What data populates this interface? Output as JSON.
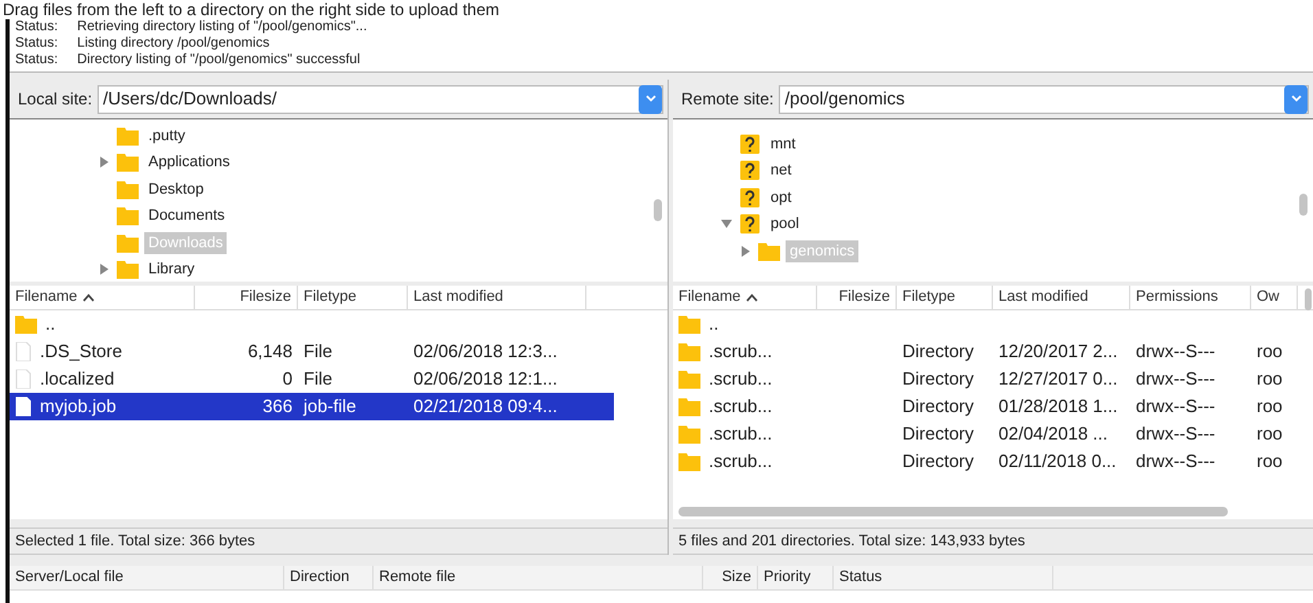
{
  "caption": "Drag files from the left to a directory on the right side to upload them",
  "log": [
    {
      "label": "Status:",
      "message": "Retrieving directory listing of \"/pool/genomics\"..."
    },
    {
      "label": "Status:",
      "message": "Listing directory /pool/genomics"
    },
    {
      "label": "Status:",
      "message": "Directory listing of \"/pool/genomics\" successful"
    }
  ],
  "panes": [
    {
      "label": "Local site:",
      "path": "/Users/dc/Downloads/",
      "tree": [
        {
          "name": ".putty",
          "kind": "folder",
          "selected": false
        },
        {
          "name": "Applications",
          "kind": "folder",
          "expanded": false,
          "selected": false
        },
        {
          "name": "Desktop",
          "kind": "folder",
          "selected": false
        },
        {
          "name": "Documents",
          "kind": "folder",
          "selected": false
        },
        {
          "name": "Downloads",
          "kind": "folder",
          "selected": true
        },
        {
          "name": "Library",
          "kind": "folder",
          "expanded": false,
          "selected": false
        }
      ],
      "columns": [
        {
          "label": "Filename",
          "sorted": true
        },
        {
          "label": "Filesize",
          "sorted": false
        },
        {
          "label": "Filetype",
          "sorted": false
        },
        {
          "label": "Last modified",
          "sorted": false
        }
      ],
      "rows": [
        {
          "kind": "folder",
          "selected": false,
          "cells": [
            ".."
          ]
        },
        {
          "kind": "file",
          "selected": false,
          "cells": [
            ".DS_Store",
            "6,148",
            "File",
            "02/06/2018 12:3..."
          ]
        },
        {
          "kind": "file",
          "selected": false,
          "cells": [
            ".localized",
            "0",
            "File",
            "02/06/2018 12:1..."
          ]
        },
        {
          "kind": "file",
          "selected": true,
          "cells": [
            "myjob.job",
            "366",
            "job-file",
            "02/21/2018 09:4..."
          ]
        }
      ],
      "status": "Selected 1 file. Total size: 366 bytes"
    },
    {
      "label": "Remote site:",
      "path": "/pool/genomics",
      "tree": [
        {
          "name": "mnt",
          "kind": "unknown",
          "selected": false
        },
        {
          "name": "net",
          "kind": "unknown",
          "selected": false
        },
        {
          "name": "opt",
          "kind": "unknown",
          "selected": false
        },
        {
          "name": "pool",
          "kind": "unknown",
          "expanded": true,
          "selected": false,
          "children": [
            {
              "name": "genomics",
              "kind": "folder",
              "expanded": false,
              "selected": true
            }
          ]
        }
      ],
      "columns": [
        {
          "label": "Filename",
          "sorted": true
        },
        {
          "label": "Filesize",
          "sorted": false
        },
        {
          "label": "Filetype",
          "sorted": false
        },
        {
          "label": "Last modified",
          "sorted": false
        },
        {
          "label": "Permissions",
          "sorted": false
        },
        {
          "label": "Ow",
          "sorted": false
        }
      ],
      "rows": [
        {
          "kind": "folder",
          "selected": false,
          "cells": [
            ".."
          ]
        },
        {
          "kind": "folder",
          "selected": false,
          "cells": [
            ".scrub...",
            "",
            "Directory",
            "12/20/2017 2...",
            "drwx--S---",
            "roo"
          ]
        },
        {
          "kind": "folder",
          "selected": false,
          "cells": [
            ".scrub...",
            "",
            "Directory",
            "12/27/2017 0...",
            "drwx--S---",
            "roo"
          ]
        },
        {
          "kind": "folder",
          "selected": false,
          "cells": [
            ".scrub...",
            "",
            "Directory",
            "01/28/2018 1...",
            "drwx--S---",
            "roo"
          ]
        },
        {
          "kind": "folder",
          "selected": false,
          "cells": [
            ".scrub...",
            "",
            "Directory",
            "02/04/2018 ...",
            "drwx--S---",
            "roo"
          ]
        },
        {
          "kind": "folder",
          "selected": false,
          "cells": [
            ".scrub...",
            "",
            "Directory",
            "02/11/2018 0...",
            "drwx--S---",
            "roo"
          ]
        }
      ],
      "status": "5 files and 201 directories. Total size: 143,933 bytes"
    }
  ],
  "queue": {
    "columns": [
      "Server/Local file",
      "Direction",
      "Remote file",
      "Size",
      "Priority",
      "Status"
    ]
  }
}
